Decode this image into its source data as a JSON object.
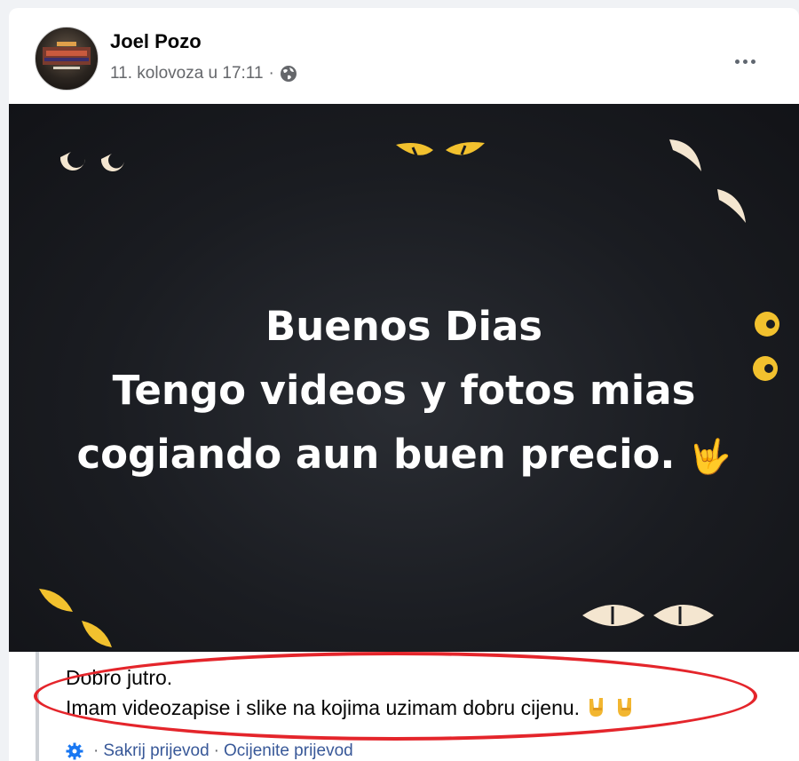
{
  "post": {
    "author": "Joel Pozo",
    "date": "11. kolovoza u 17:11",
    "separator": "·",
    "privacy_icon": "globe-icon",
    "more_icon": "more-options-icon",
    "image_text": {
      "line1": "Buenos Dias",
      "line2": "Tengo videos y fotos mias",
      "line3": "cogiando aun buen precio.",
      "emoji": "🤟"
    }
  },
  "translation": {
    "line1": "Dobro jutro.",
    "line2": "Imam videozapise i slike na kojima uzimam dobru cijenu.",
    "hide_label": "Sakrij prijevod",
    "rate_label": "Ocijenite prijevod",
    "separator": "·",
    "icon": "gear-icon"
  },
  "colors": {
    "link": "#385898",
    "secondary_text": "#65676b",
    "highlight": "#e4252b",
    "image_background": "#1a1c21",
    "eyes_yellow": "#f2c12e",
    "eyes_cream": "#f4e6d0"
  }
}
